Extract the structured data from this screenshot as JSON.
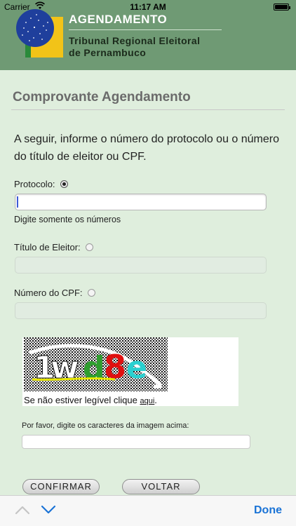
{
  "status_bar": {
    "carrier": "Carrier",
    "time": "11:17 AM"
  },
  "header": {
    "title": "AGENDAMENTO",
    "subtitle_line1": "Tribunal Regional Eleitoral",
    "subtitle_line2": "de Pernambuco"
  },
  "page": {
    "section_title": "Comprovante Agendamento",
    "intro": "A seguir, informe o número do protocolo ou o número do título de eleitor ou CPF."
  },
  "form": {
    "protocolo_label": "Protocolo:",
    "protocolo_value": "",
    "protocolo_hint": "Digite somente os números",
    "titulo_label": "Título de Eleitor:",
    "titulo_value": "",
    "cpf_label": "Número do CPF:",
    "cpf_value": "",
    "selected_option": "protocolo"
  },
  "captcha": {
    "image_text": "1wd8e",
    "unreadable_text": "Se não estiver legível clique ",
    "link_text": "aqui",
    "link_suffix": ".",
    "input_label": "Por favor, digite os caracteres da imagem acima:",
    "input_value": ""
  },
  "buttons": {
    "confirm": "CONFIRMAR",
    "back": "VOLTAR"
  },
  "accessory_bar": {
    "done": "Done"
  },
  "icons": {
    "wifi": "wifi-icon",
    "battery": "battery-icon",
    "up": "chevron-up-icon",
    "down": "chevron-down-icon"
  },
  "colors": {
    "header_bg": "#6f9a74",
    "page_bg": "#dfeedd",
    "link_blue": "#1a73d6"
  }
}
